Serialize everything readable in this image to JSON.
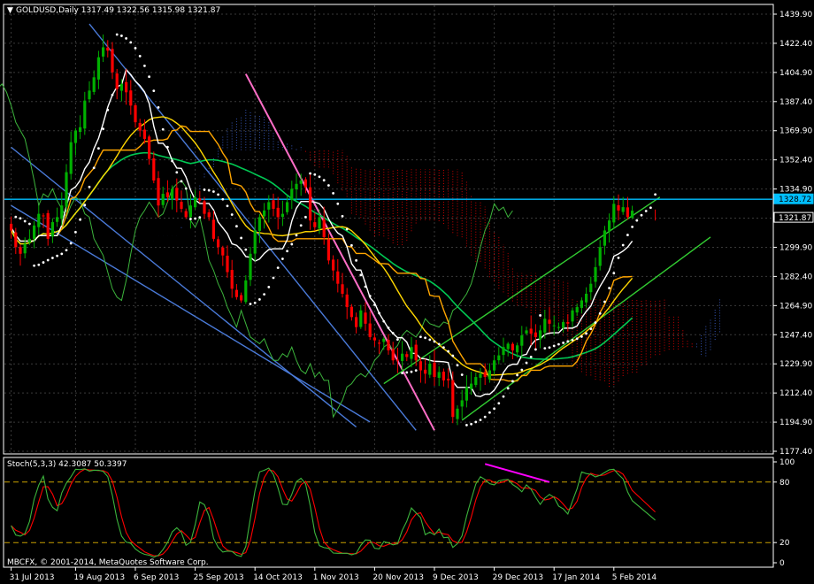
{
  "chart_data": [
    {
      "type": "candlestick",
      "header": "GOLDUSD,Daily  1317.49 1322.56 1315.98 1321.87",
      "symbol": "GOLDUSD",
      "timeframe": "Daily",
      "ohlc_last": {
        "open": 1317.49,
        "high": 1322.56,
        "low": 1315.98,
        "close": 1321.87
      },
      "ylim": [
        1177.4,
        1439.9
      ],
      "y_ticks": [
        "1439.90",
        "1422.40",
        "1404.90",
        "1387.40",
        "1369.90",
        "1352.40",
        "1334.90",
        "1317.40",
        "1299.90",
        "1282.40",
        "1264.90",
        "1247.40",
        "1229.90",
        "1212.40",
        "1194.90",
        "1177.40"
      ],
      "y_tick_values": [
        1439.9,
        1422.4,
        1404.9,
        1387.4,
        1369.9,
        1352.4,
        1334.9,
        1317.4,
        1299.9,
        1282.4,
        1264.9,
        1247.4,
        1229.9,
        1212.4,
        1194.9,
        1177.4
      ],
      "price_labels": [
        {
          "text": "1328.72",
          "value": 1328.72,
          "color": "#00bfff"
        },
        {
          "text": "1321.87",
          "value": 1321.87,
          "color": "#ffffff"
        }
      ],
      "resistance_level": 1328.72,
      "x_ticks": [
        "31 Jul 2013",
        "19 Aug 2013",
        "6 Sep 2013",
        "25 Sep 2013",
        "14 Oct 2013",
        "1 Nov 2013",
        "20 Nov 2013",
        "9 Dec 2013",
        "29 Dec 2013",
        "17 Jan 2014",
        "5 Feb 2014"
      ],
      "x_tick_bar_index": [
        0,
        14,
        27,
        40,
        53,
        66,
        79,
        92,
        105,
        118,
        131
      ],
      "bar_count": 141,
      "colors": {
        "up": "#00b000",
        "down": "#ff0000",
        "grid": "#3a3a3a",
        "axis": "#ffffff"
      },
      "close_series": [
        1310,
        1300,
        1296,
        1302,
        1305,
        1313,
        1320,
        1319,
        1305,
        1315,
        1318,
        1325,
        1345,
        1363,
        1370,
        1372,
        1388,
        1394,
        1402,
        1414,
        1420,
        1418,
        1405,
        1395,
        1398,
        1393,
        1385,
        1375,
        1370,
        1365,
        1353,
        1340,
        1325,
        1332,
        1330,
        1335,
        1328,
        1323,
        1318,
        1325,
        1330,
        1328,
        1320,
        1318,
        1305,
        1300,
        1295,
        1285,
        1275,
        1270,
        1268,
        1280,
        1296,
        1310,
        1318,
        1322,
        1327,
        1323,
        1318,
        1320,
        1327,
        1335,
        1338,
        1340,
        1336,
        1316,
        1312,
        1318,
        1306,
        1292,
        1286,
        1278,
        1272,
        1264,
        1258,
        1252,
        1262,
        1254,
        1246,
        1244,
        1242,
        1245,
        1238,
        1232,
        1232,
        1236,
        1234,
        1240,
        1232,
        1226,
        1224,
        1230,
        1222,
        1225,
        1220,
        1220,
        1198,
        1203,
        1208,
        1216,
        1218,
        1222,
        1224,
        1222,
        1226,
        1232,
        1235,
        1240,
        1242,
        1238,
        1241,
        1247,
        1250,
        1248,
        1246,
        1250,
        1257,
        1254,
        1253,
        1252,
        1255,
        1254,
        1262,
        1264,
        1268,
        1272,
        1278,
        1288,
        1300,
        1310,
        1316,
        1326,
        1322,
        1324,
        1318,
        1321.87
      ],
      "series": [
        {
          "name": "",
          "color": "#ffffff",
          "kind": "stepped-line"
        },
        {
          "name": "",
          "color": "#ffa500",
          "kind": "stepped-line"
        },
        {
          "name": "",
          "color": "#ffd700",
          "kind": "moving-average"
        },
        {
          "name": "",
          "color": "#00c853",
          "kind": "moving-average"
        },
        {
          "name": "",
          "color": "#3cb43c",
          "kind": "chikou-line"
        },
        {
          "name": "",
          "color": "#ffffff",
          "kind": "parabolic-sar-dots"
        },
        {
          "name": "",
          "color": "#ff0000",
          "kind": "cloud-dotted"
        },
        {
          "name": "",
          "color": "#4169e1",
          "kind": "cloud-dotted"
        }
      ],
      "trendlines": [
        {
          "color": "#4a7ad8",
          "description": "upper descending channel line"
        },
        {
          "color": "#4a7ad8",
          "description": "lower descending channel line"
        },
        {
          "color": "#4a7ad8",
          "description": "middle descending channel line"
        },
        {
          "color": "#ff6ec7",
          "description": "steep descending line"
        },
        {
          "color": "#32cd32",
          "description": "upper ascending channel line"
        },
        {
          "color": "#32cd32",
          "description": "lower ascending channel line"
        },
        {
          "color": "#00bfff",
          "description": "horizontal resistance at 1328.72"
        }
      ]
    },
    {
      "type": "line",
      "header": "Stoch(5,3,3) 42.3087 50.3397",
      "indicator": "Stoch(5,3,3)",
      "main_value": 42.3087,
      "signal_value": 50.3397,
      "ylim": [
        0,
        100
      ],
      "y_ticks": [
        "100",
        "80",
        "20",
        "0"
      ],
      "y_tick_values": [
        100,
        80,
        20,
        0
      ],
      "levels": [
        80,
        20
      ],
      "series": [
        {
          "name": "",
          "color": "#3cb43c"
        },
        {
          "name": "",
          "color": "#ff0000"
        }
      ],
      "divergence_color": "#ff00ff",
      "divergence_values": [
        98,
        80
      ]
    }
  ],
  "footer": {
    "copyright": "MBCFX, © 2001-2014, MetaQuotes Software Corp."
  }
}
